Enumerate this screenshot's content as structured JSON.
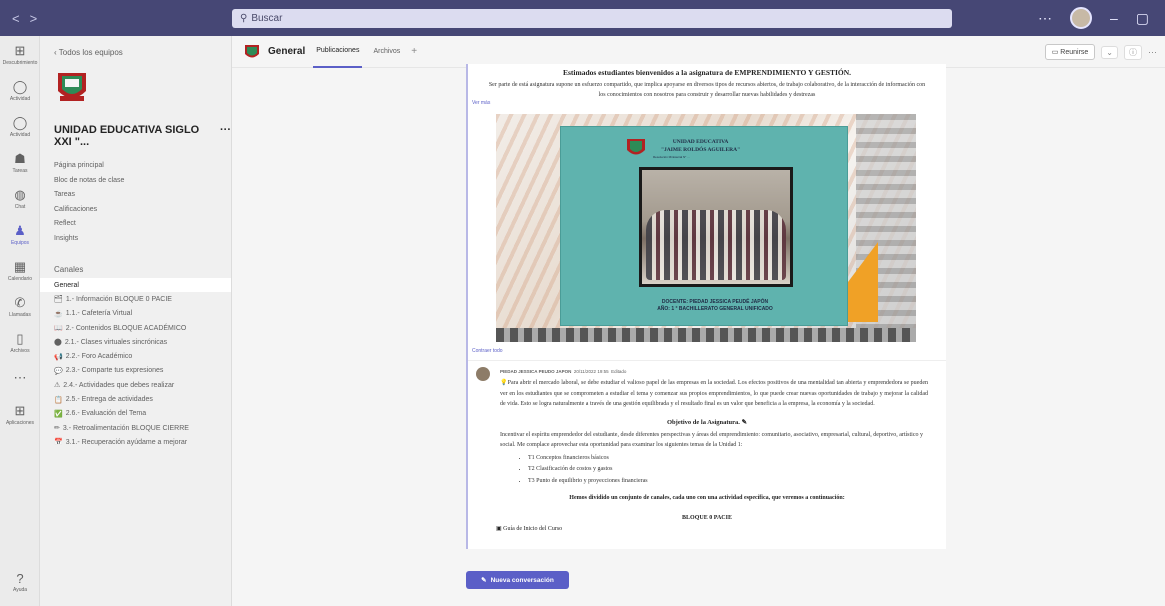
{
  "search": {
    "placeholder": "Buscar"
  },
  "rail": [
    {
      "label": "Descubrimiento",
      "icon": "grid-icon"
    },
    {
      "label": "Actividad",
      "icon": "bell-icon"
    },
    {
      "label": "Actividad",
      "icon": "bell-icon"
    },
    {
      "label": "Tareas",
      "icon": "tasks-icon"
    },
    {
      "label": "Chat",
      "icon": "chat-icon"
    },
    {
      "label": "Equipos",
      "icon": "teams-icon"
    },
    {
      "label": "Calendario",
      "icon": "calendar-icon"
    },
    {
      "label": "Llamadas",
      "icon": "phone-icon"
    },
    {
      "label": "Archivos",
      "icon": "file-icon"
    },
    {
      "label": "",
      "icon": "more-icon"
    },
    {
      "label": "Aplicaciones",
      "icon": "apps-icon"
    }
  ],
  "rail_bottom": {
    "label": "Ayuda"
  },
  "sidebar": {
    "back": "Todos los equipos",
    "team_name": "UNIDAD EDUCATIVA SIGLO XXI \"...",
    "team_more": "···",
    "links": [
      "Página principal",
      "Bloc de notas de clase",
      "Tareas",
      "Calificaciones",
      "Reflect",
      "Insights"
    ],
    "channels_head": "Canales",
    "channels": [
      {
        "label": "General",
        "icon": ""
      },
      {
        "label": "1.- Información BLOQUE 0 PACIE",
        "icon": "🗂"
      },
      {
        "label": "1.1.- Cafetería Virtual",
        "icon": "☕"
      },
      {
        "label": "2.- Contenidos BLOQUE ACADÉMICO",
        "icon": "📖"
      },
      {
        "label": "2.1.- Clases virtuales sincrónicas",
        "icon": "⬤"
      },
      {
        "label": "2.2.- Foro Académico",
        "icon": "📢"
      },
      {
        "label": "2.3.- Comparte tus expresiones",
        "icon": "💬"
      },
      {
        "label": "2.4.- Actividades que debes realizar",
        "icon": "⚠"
      },
      {
        "label": "2.5.- Entrega de actividades",
        "icon": "📋"
      },
      {
        "label": "2.6.- Evaluación del Tema",
        "icon": "✅"
      },
      {
        "label": "3.- Retroalimentación BLOQUE CIERRE",
        "icon": "✏"
      },
      {
        "label": "3.1.- Recuperación ayúdame a mejorar",
        "icon": "📅"
      }
    ]
  },
  "header": {
    "channel": "General",
    "tabs": [
      "Publicaciones",
      "Archivos"
    ],
    "add_tab": "+",
    "meet": "Reunirse",
    "more": "⋯"
  },
  "post": {
    "title": "Estimados estudiantes bienvenidos a la asignatura de EMPRENDIMIENTO Y GESTIÓN.",
    "text": "Ser parte de está asignatura supone un esfuerzo compartido, que implica apoyarse en diversos tipos de recursos abiertos, de trabajo colaborativo, de la interacción de información con los conocimientos con nosotros para construir y desarrollar nuevas habilidades y destrezas",
    "see_more": "Ver más",
    "card": {
      "school": "UNIDAD EDUCATIVA\n\"JAIME ROLDÓS AGUILERA\"",
      "sub": "Resolución Ministerial N° ...",
      "docente": "DOCENTE: PIEDAD JESSICA PEUDÉ JAPÓN",
      "anio": "AÑO: 1 ° BACHILLERATO GENERAL UNIFICADO"
    },
    "see_less": "Contraer todo"
  },
  "reply": {
    "author": "PIEDAD JESSICA PEUDO JAPON",
    "time": "20/11/2022 19:55",
    "edited": "Editado",
    "body": "Para abrir el mercado laboral, se debe estudiar el valioso papel de las empresas en la sociedad. Los efectos positivos de una mentalidad tan abierta y emprendedora se pueden ver en los estudiantes que se comprometen a estudiar el tema y comenzar sus propios emprendimientos, lo que puede crear nuevas oportunidades de trabajo y mejorar la calidad de vida. Esto se logra naturalmente a través de una gestión equilibrada y el resultado final es un valor que beneficia a la empresa, la economía y la sociedad.",
    "objective_title": "Objetivo de la Asignatura.",
    "objective_text": "Incentivar el espíritu emprendedor del estudiante, desde diferentes perspectivas y áreas del emprendimiento: comunitario, asociativo, empresarial, cultural, deportivo, artístico y social. Me complace aprovechar esta oportunidad para examinar los siguientes temas de la Unidad 1:",
    "topics": [
      "T1 Conceptos financieros básicos",
      "T2 Clasificación de costos y gastos",
      "T3 Punto de equilibrio y proyecciones financieras"
    ],
    "channels_note": "Hemos dividido un conjunto de canales, cada uno con una actividad específica, que veremos a continuación:",
    "bloque": "BLOQUE 0 PACIE",
    "guia": "Guía de Inicio del Curso"
  },
  "new_conversation": "Nueva conversación",
  "colors": {
    "titlebar": "#464775",
    "accent": "#5b5fc7"
  }
}
